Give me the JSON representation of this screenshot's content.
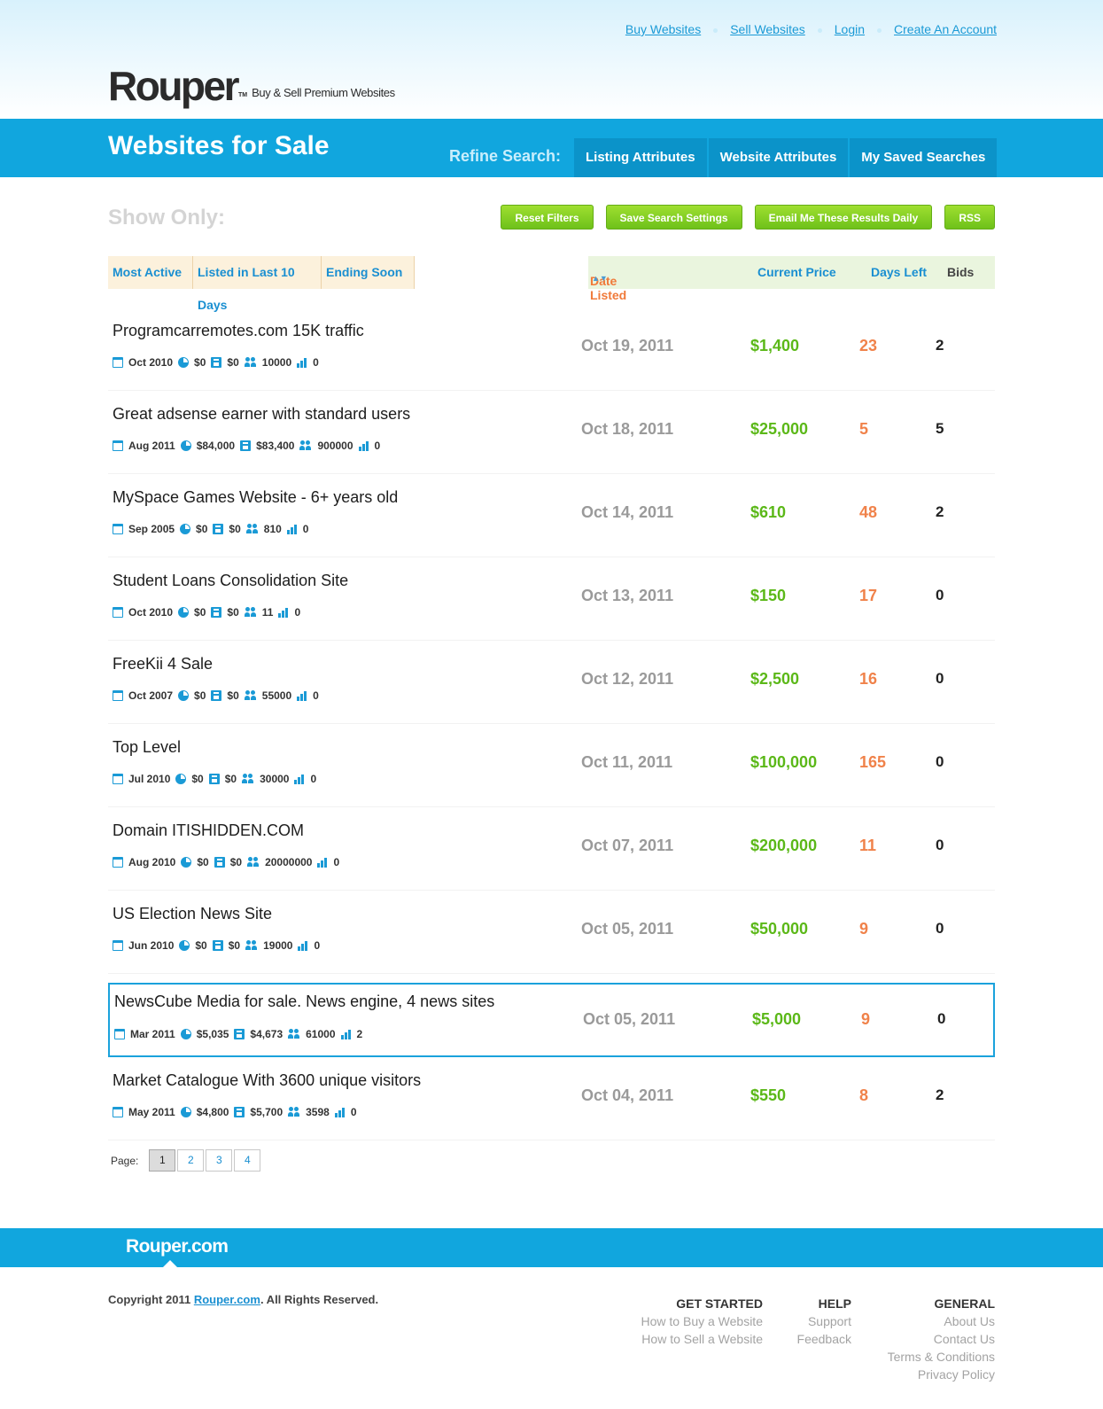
{
  "top_links": [
    "Buy Websites",
    "Sell Websites",
    "Login",
    "Create An Account"
  ],
  "logo": {
    "name": "Rouper",
    "tm": "TM",
    "tagline": "Buy & Sell Premium Websites"
  },
  "header": {
    "title": "Websites for Sale",
    "refine_label": "Refine Search:",
    "tabs": [
      "Listing Attributes",
      "Website Attributes",
      "My Saved Searches"
    ]
  },
  "show_only": "Show Only:",
  "action_buttons": [
    "Reset Filters",
    "Save Search Settings",
    "Email Me These Results Daily",
    "RSS"
  ],
  "filters": [
    "Most Active",
    "Listed in Last 10 Days",
    "Ending Soon"
  ],
  "columns": {
    "date": "Date Listed",
    "price": "Current Price",
    "days": "Days Left",
    "bids": "Bids"
  },
  "listings": [
    {
      "name": "Programcarremotes.com 15K traffic",
      "established": "Oct 2010",
      "revenue": "$0",
      "profit": "$0",
      "visitors": "10000",
      "pagerank": "0",
      "date": "Oct 19, 2011",
      "price": "$1,400",
      "days": "23",
      "bids": "2"
    },
    {
      "name": "Great adsense earner with standard users",
      "established": "Aug 2011",
      "revenue": "$84,000",
      "profit": "$83,400",
      "visitors": "900000",
      "pagerank": "0",
      "date": "Oct 18, 2011",
      "price": "$25,000",
      "days": "5",
      "bids": "5"
    },
    {
      "name": "MySpace Games Website - 6+ years old",
      "established": "Sep 2005",
      "revenue": "$0",
      "profit": "$0",
      "visitors": "810",
      "pagerank": "0",
      "date": "Oct 14, 2011",
      "price": "$610",
      "days": "48",
      "bids": "2"
    },
    {
      "name": "Student Loans Consolidation Site",
      "established": "Oct 2010",
      "revenue": "$0",
      "profit": "$0",
      "visitors": "11",
      "pagerank": "0",
      "date": "Oct 13, 2011",
      "price": "$150",
      "days": "17",
      "bids": "0"
    },
    {
      "name": "FreeKii 4 Sale",
      "established": "Oct 2007",
      "revenue": "$0",
      "profit": "$0",
      "visitors": "55000",
      "pagerank": "0",
      "date": "Oct 12, 2011",
      "price": "$2,500",
      "days": "16",
      "bids": "0"
    },
    {
      "name": "Top Level",
      "established": "Jul 2010",
      "revenue": "$0",
      "profit": "$0",
      "visitors": "30000",
      "pagerank": "0",
      "date": "Oct 11, 2011",
      "price": "$100,000",
      "days": "165",
      "bids": "0"
    },
    {
      "name": "Domain ITISHIDDEN.COM",
      "established": "Aug 2010",
      "revenue": "$0",
      "profit": "$0",
      "visitors": "20000000",
      "pagerank": "0",
      "date": "Oct 07, 2011",
      "price": "$200,000",
      "days": "11",
      "bids": "0"
    },
    {
      "name": "US Election News Site",
      "established": "Jun 2010",
      "revenue": "$0",
      "profit": "$0",
      "visitors": "19000",
      "pagerank": "0",
      "date": "Oct 05, 2011",
      "price": "$50,000",
      "days": "9",
      "bids": "0"
    },
    {
      "name": "NewsCube Media for sale. News engine, 4 news sites",
      "established": "Mar 2011",
      "revenue": "$5,035",
      "profit": "$4,673",
      "visitors": "61000",
      "pagerank": "2",
      "date": "Oct 05, 2011",
      "price": "$5,000",
      "days": "9",
      "bids": "0"
    },
    {
      "name": "Market Catalogue With 3600 unique visitors",
      "established": "May 2011",
      "revenue": "$4,800",
      "profit": "$5,700",
      "visitors": "3598",
      "pagerank": "0",
      "date": "Oct 04, 2011",
      "price": "$550",
      "days": "8",
      "bids": "2"
    }
  ],
  "pager": {
    "label": "Page:",
    "pages": [
      "1",
      "2",
      "3",
      "4"
    ],
    "current": "1"
  },
  "footer": {
    "logo": "Rouper.com",
    "copyright_pre": "Copyright 2011 ",
    "copyright_link": "Rouper.com",
    "copyright_post": ". All Rights Reserved.",
    "columns": [
      {
        "heading": "GET STARTED",
        "links": [
          "How to Buy a Website",
          "How to Sell a Website"
        ]
      },
      {
        "heading": "HELP",
        "links": [
          "Support",
          "Feedback"
        ]
      },
      {
        "heading": "GENERAL",
        "links": [
          "About Us",
          "Contact Us",
          "Terms & Conditions",
          "Privacy Policy"
        ]
      }
    ]
  },
  "colors": {
    "brand_blue": "#11a6de",
    "price_green": "#5bb818",
    "days_orange": "#f0824a",
    "button_green": "#7cc81f"
  }
}
